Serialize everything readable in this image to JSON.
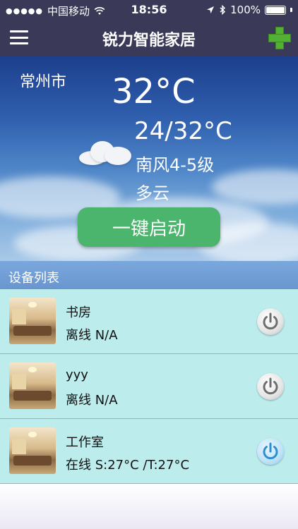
{
  "status_bar": {
    "carrier": "中国移动",
    "time": "18:56",
    "battery": "100%",
    "signal_icon": "signal-dots-icon",
    "wifi_icon": "wifi-icon",
    "location_icon": "location-arrow-icon",
    "bluetooth_icon": "bluetooth-icon"
  },
  "nav": {
    "title": "锐力智能家居",
    "menu_icon": "hamburger-menu-icon",
    "add_icon": "plus-icon",
    "add_color": "#53b034"
  },
  "weather": {
    "city": "常州市",
    "temperature": "32°C",
    "range": "24/32°C",
    "wind": "南风4-5级",
    "condition": "多云",
    "condition_icon": "cloud-icon",
    "start_button": "一键启动",
    "start_button_color": "#4cb56d"
  },
  "device_section": {
    "title": "设备列表"
  },
  "devices": [
    {
      "name": "书房",
      "status": "离线  N/A",
      "power": "off"
    },
    {
      "name": "yyy",
      "status": "离线  N/A",
      "power": "off"
    },
    {
      "name": "工作室",
      "status": "在线  S:27°C /T:27°C",
      "power": "on"
    }
  ],
  "colors": {
    "nav_bg": "#3a3a58",
    "row_bg": "#bcecec",
    "section_bg": "#7aa7dc",
    "power_on": "#2d8fd0",
    "power_off": "#6d6d6d"
  }
}
